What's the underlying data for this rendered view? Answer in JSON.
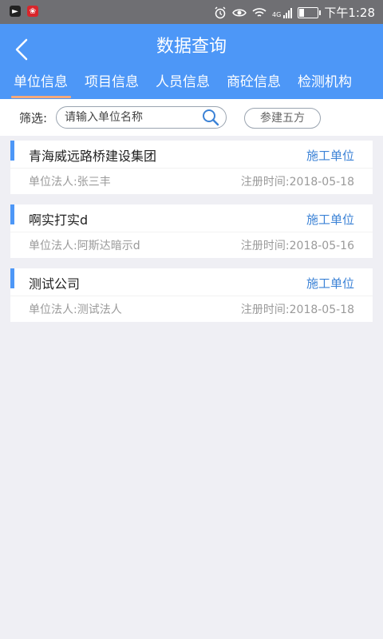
{
  "status_bar": {
    "time": "下午1:28",
    "signal_text": "4G",
    "icons": [
      "app-icon",
      "huawei-icon",
      "alarm-icon",
      "eye-icon",
      "wifi-icon",
      "signal-icon",
      "battery-icon"
    ]
  },
  "header": {
    "title": "数据查询",
    "tabs": [
      {
        "label": "单位信息",
        "active": true
      },
      {
        "label": "项目信息",
        "active": false
      },
      {
        "label": "人员信息",
        "active": false
      },
      {
        "label": "商砼信息",
        "active": false
      },
      {
        "label": "检测机构",
        "active": false
      }
    ],
    "colors": {
      "bar": "#4d97f7",
      "indicator": "#f4a97b"
    }
  },
  "filter": {
    "label": "筛选:",
    "search_placeholder": "请输入单位名称",
    "search_value": "",
    "button_label": "参建五方"
  },
  "units": [
    {
      "name": "青海威远路桥建设集团",
      "type": "施工单位",
      "legal_label": "单位法人:",
      "legal_person": "张三丰",
      "reg_label": "注册时间:",
      "reg_date": "2018-05-18"
    },
    {
      "name": "啊实打实d",
      "type": "施工单位",
      "legal_label": "单位法人:",
      "legal_person": "阿斯达暗示d",
      "reg_label": "注册时间:",
      "reg_date": "2018-05-16"
    },
    {
      "name": "测试公司",
      "type": "施工单位",
      "legal_label": "单位法人:",
      "legal_person": "测试法人",
      "reg_label": "注册时间:",
      "reg_date": "2018-05-18"
    }
  ]
}
